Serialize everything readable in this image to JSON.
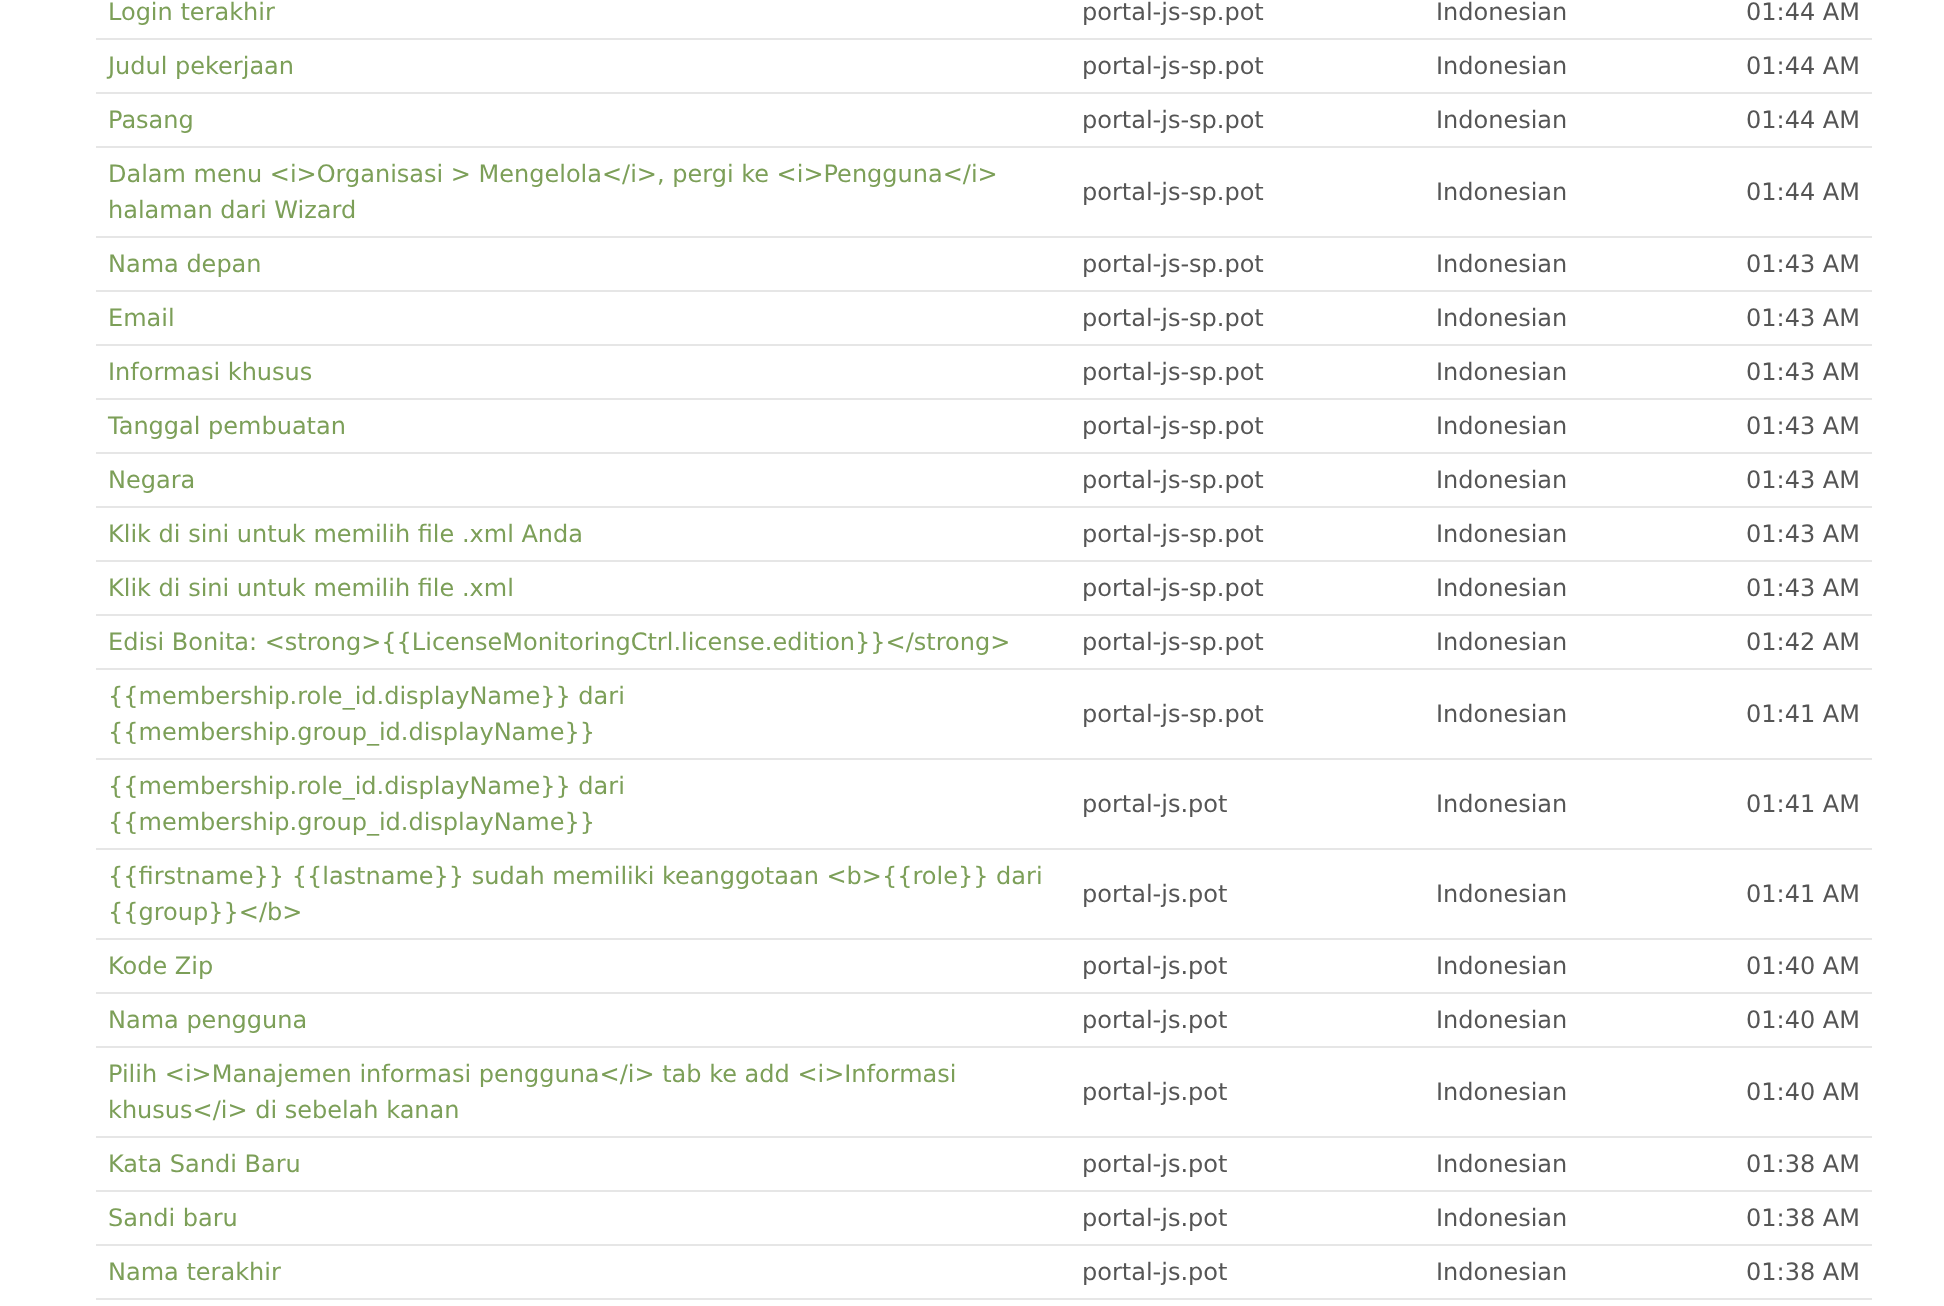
{
  "table": {
    "rows": [
      {
        "string": "Login terakhir",
        "file": "portal-js-sp.pot",
        "language": "Indonesian",
        "time": "01:44 AM"
      },
      {
        "string": "Judul pekerjaan",
        "file": "portal-js-sp.pot",
        "language": "Indonesian",
        "time": "01:44 AM"
      },
      {
        "string": "Pasang",
        "file": "portal-js-sp.pot",
        "language": "Indonesian",
        "time": "01:44 AM"
      },
      {
        "string": "Dalam menu <i>Organisasi > Mengelola</i>, pergi ke <i>Pengguna</i> halaman dari Wizard",
        "file": "portal-js-sp.pot",
        "language": "Indonesian",
        "time": "01:44 AM"
      },
      {
        "string": "Nama depan",
        "file": "portal-js-sp.pot",
        "language": "Indonesian",
        "time": "01:43 AM"
      },
      {
        "string": "Email",
        "file": "portal-js-sp.pot",
        "language": "Indonesian",
        "time": "01:43 AM"
      },
      {
        "string": "Informasi khusus",
        "file": "portal-js-sp.pot",
        "language": "Indonesian",
        "time": "01:43 AM"
      },
      {
        "string": "Tanggal pembuatan",
        "file": "portal-js-sp.pot",
        "language": "Indonesian",
        "time": "01:43 AM"
      },
      {
        "string": "Negara",
        "file": "portal-js-sp.pot",
        "language": "Indonesian",
        "time": "01:43 AM"
      },
      {
        "string": "Klik di sini untuk memilih file .xml Anda",
        "file": "portal-js-sp.pot",
        "language": "Indonesian",
        "time": "01:43 AM"
      },
      {
        "string": "Klik di sini untuk memilih file .xml",
        "file": "portal-js-sp.pot",
        "language": "Indonesian",
        "time": "01:43 AM"
      },
      {
        "string": "Edisi Bonita: <strong>{{LicenseMonitoringCtrl.license.edition}}</strong>",
        "file": "portal-js-sp.pot",
        "language": "Indonesian",
        "time": "01:42 AM"
      },
      {
        "string": "{{membership.role_id.displayName}} dari {{membership.group_id.displayName}}",
        "file": "portal-js-sp.pot",
        "language": "Indonesian",
        "time": "01:41 AM"
      },
      {
        "string": "{{membership.role_id.displayName}} dari {{membership.group_id.displayName}}",
        "file": "portal-js.pot",
        "language": "Indonesian",
        "time": "01:41 AM"
      },
      {
        "string": "{{firstname}} {{lastname}} sudah memiliki keanggotaan <b>{{role}} dari {{group}}</b>",
        "file": "portal-js.pot",
        "language": "Indonesian",
        "time": "01:41 AM"
      },
      {
        "string": "Kode Zip",
        "file": "portal-js.pot",
        "language": "Indonesian",
        "time": "01:40 AM"
      },
      {
        "string": "Nama pengguna",
        "file": "portal-js.pot",
        "language": "Indonesian",
        "time": "01:40 AM"
      },
      {
        "string": "Pilih <i>Manajemen informasi pengguna</i> tab ke add <i>Informasi khusus</i> di sebelah kanan",
        "file": "portal-js.pot",
        "language": "Indonesian",
        "time": "01:40 AM"
      },
      {
        "string": "Kata Sandi Baru",
        "file": "portal-js.pot",
        "language": "Indonesian",
        "time": "01:38 AM"
      },
      {
        "string": "Sandi baru",
        "file": "portal-js.pot",
        "language": "Indonesian",
        "time": "01:38 AM"
      },
      {
        "string": "Nama terakhir",
        "file": "portal-js.pot",
        "language": "Indonesian",
        "time": "01:38 AM"
      }
    ]
  }
}
